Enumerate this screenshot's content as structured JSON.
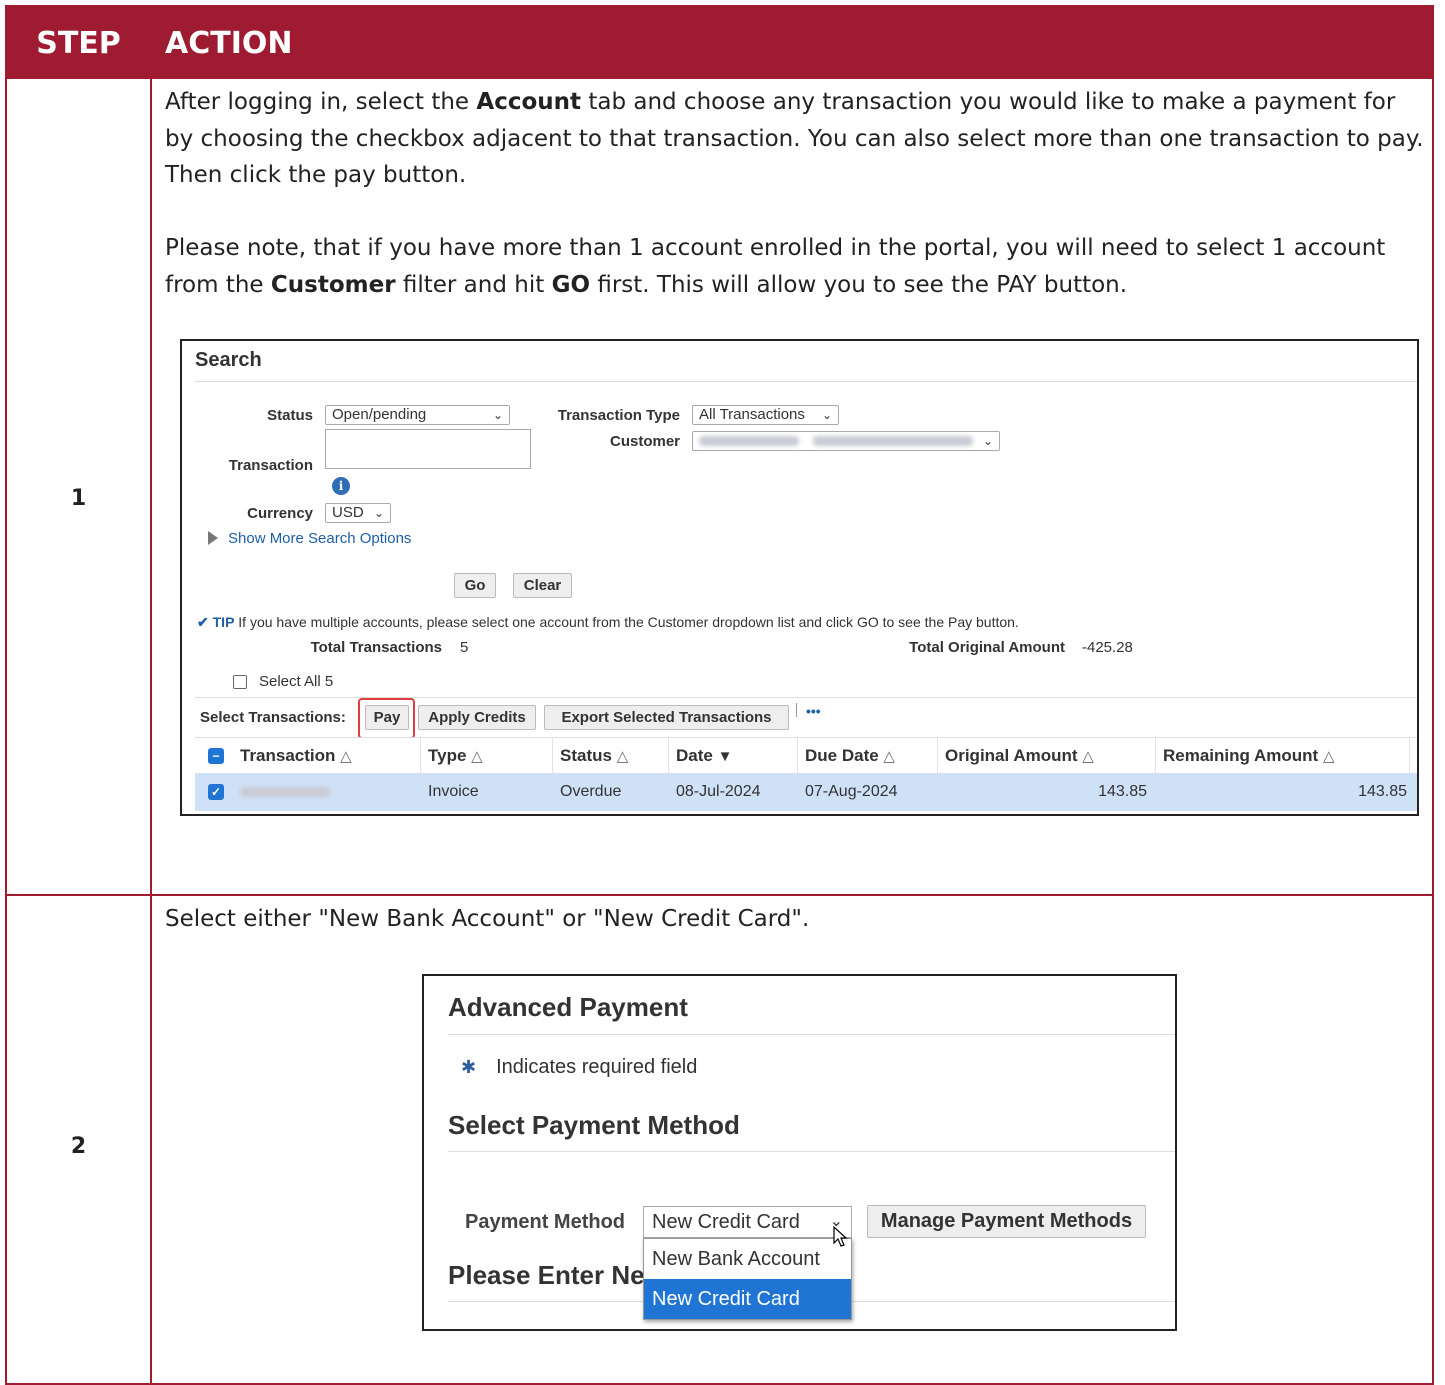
{
  "table": {
    "headers": [
      "STEP",
      "ACTION"
    ],
    "rows": [
      {
        "step": "1",
        "para1": {
          "p1": "After logging in, select the ",
          "b1": "Account",
          "p2": " tab and choose any transaction you would like to make a payment for by choosing the checkbox adjacent to that transaction. You can also select more than one transaction to pay. Then click the pay button."
        },
        "para2": {
          "p1": "Please note, that if you have more than 1 account enrolled in the portal, you will need to select 1 account from the ",
          "b1": "Customer",
          "p2": " filter and hit ",
          "b2": "GO",
          "p3": " first. This will allow you to see the PAY button."
        }
      },
      {
        "step": "2",
        "para1": "Select either \"New Bank Account\" or \"New Credit Card\"."
      }
    ]
  },
  "search_screenshot": {
    "title": "Search",
    "status_label": "Status",
    "status_value": "Open/pending",
    "transaction_type_label": "Transaction Type",
    "transaction_type_value": "All Transactions",
    "customer_label": "Customer",
    "transaction_label": "Transaction",
    "currency_label": "Currency",
    "currency_value": "USD",
    "show_more_link": "Show More Search Options",
    "go_button": "Go",
    "clear_button": "Clear",
    "tip_prefix": "TIP",
    "tip_text": "If you have multiple accounts, please select one account from the Customer dropdown list and click GO to see the Pay button.",
    "total_transactions_label": "Total Transactions",
    "total_transactions_value": "5",
    "total_original_amount_label": "Total Original Amount",
    "total_original_amount_value": "-425.28",
    "select_all_label": "Select All 5",
    "select_transactions_label": "Select Transactions:",
    "pay_button": "Pay",
    "apply_credits_button": "Apply Credits",
    "export_button": "Export Selected Transactions",
    "more_icon": "•••",
    "columns": [
      "Transaction",
      "Type",
      "Status",
      "Date",
      "Due Date",
      "Original Amount",
      "Remaining Amount"
    ],
    "row": {
      "type": "Invoice",
      "status": "Overdue",
      "date": "08-Jul-2024",
      "due_date": "07-Aug-2024",
      "original_amount": "143.85",
      "remaining_amount": "143.85"
    }
  },
  "payment_screenshot": {
    "title": "Advanced Payment",
    "required_text": "Indicates required field",
    "section_title": "Select Payment Method",
    "payment_method_label": "Payment Method",
    "payment_method_value": "New Credit Card",
    "manage_button": "Manage Payment Methods",
    "next_section_partial": "Please Enter Ne",
    "options": [
      "New Bank Account",
      "New Credit Card"
    ]
  },
  "colors": {
    "header_bg": "#9e1b32",
    "selected_row_bg": "#cfe1f7",
    "highlight_option": "#1f74d4",
    "pay_callout": "#e23b3b"
  }
}
